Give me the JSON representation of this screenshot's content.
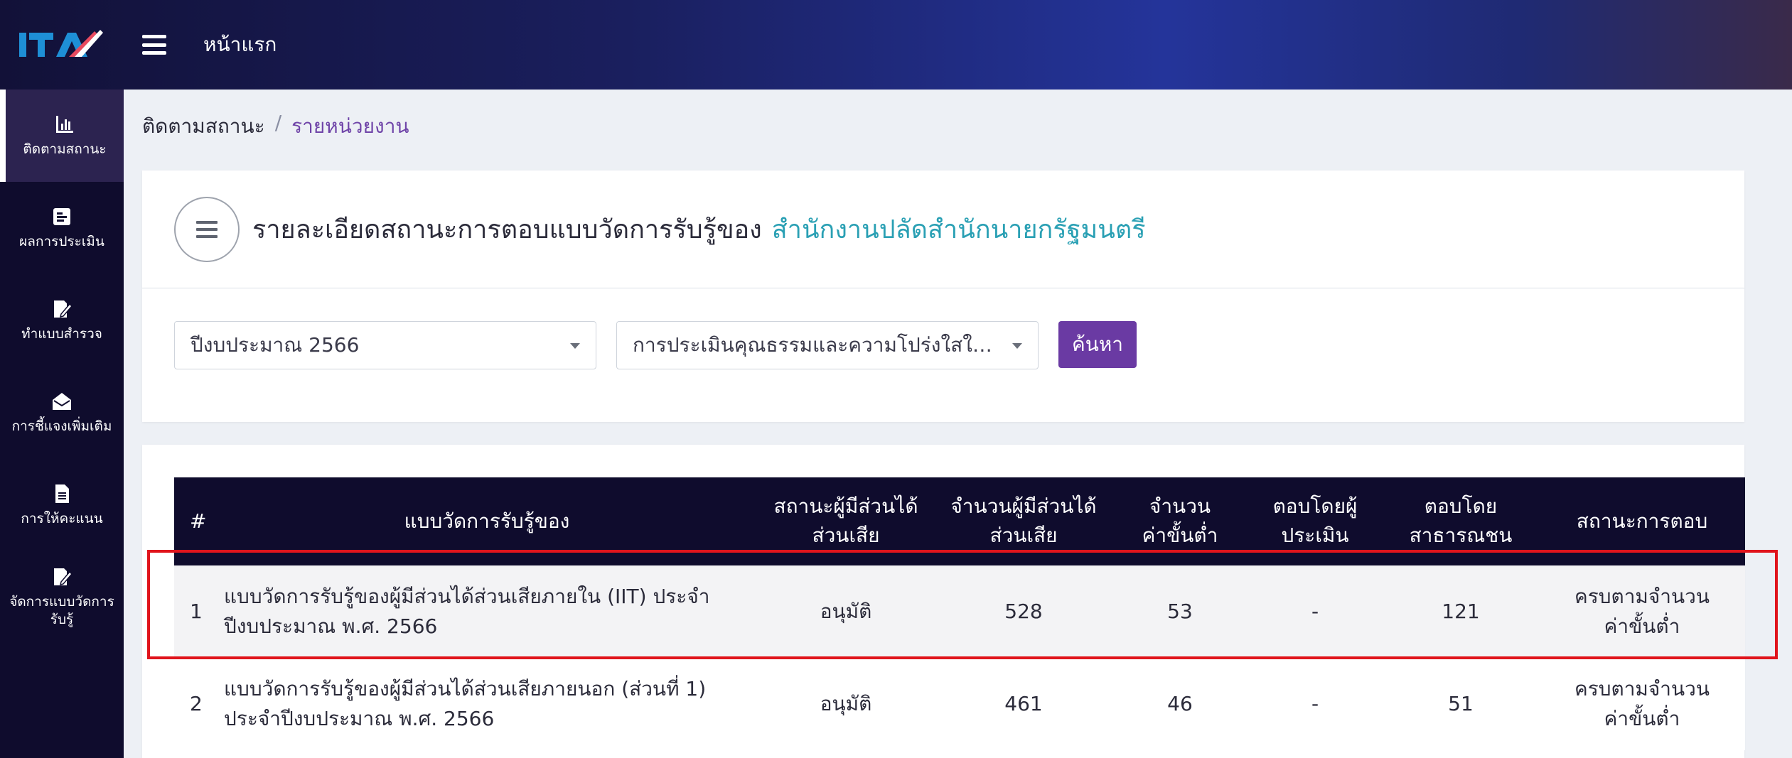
{
  "header": {
    "home_label": "หน้าแรก"
  },
  "sidebar": {
    "items": [
      {
        "label": "ติดตามสถานะ",
        "icon": "bar-chart-icon"
      },
      {
        "label": "ผลการประเมิน",
        "icon": "form-icon"
      },
      {
        "label": "ทำแบบสำรวจ",
        "icon": "edit-document-icon"
      },
      {
        "label": "การชี้แจงเพิ่มเติม",
        "icon": "envelope-icon"
      },
      {
        "label": "การให้คะแนน",
        "icon": "document-icon"
      },
      {
        "label": "จัดการแบบวัดการรับรู้",
        "icon": "edit-document-icon"
      }
    ]
  },
  "breadcrumb": {
    "parent": "ติดตามสถานะ",
    "separator": "/",
    "current": "รายหน่วยงาน"
  },
  "title": {
    "text": "รายละเอียดสถานะการตอบแบบวัดการรับรู้ของ",
    "organization": "สำนักงานปลัดสำนักนายกรัฐมนตรี"
  },
  "filters": {
    "year": "ปีงบประมาณ 2566",
    "assessment": "การประเมินคุณธรรมและความโปร่งใสในกา...",
    "search_label": "ค้นหา"
  },
  "table": {
    "headers": {
      "num": "#",
      "name": "แบบวัดการรับรู้ของ",
      "stakeholder_status": "สถานะผู้มีส่วนได้ส่วนเสีย",
      "stakeholder_count": "จำนวนผู้มีส่วนได้ส่วนเสีย",
      "min_count": "จำนวนค่าขั้นต่ำ",
      "by_assessor": "ตอบโดยผู้ประเมิน",
      "by_public": "ตอบโดยสาธารณชน",
      "response_status": "สถานะการตอบ"
    },
    "rows": [
      {
        "num": "1",
        "name": "แบบวัดการรับรู้ของผู้มีส่วนได้ส่วนเสียภายใน (IIT) ประจำปีงบประมาณ พ.ศ. 2566",
        "stakeholder_status": "อนุมัติ",
        "stakeholder_count": "528",
        "min_count": "53",
        "by_assessor": "-",
        "by_public": "121",
        "response_status": "ครบตามจำนวนค่าขั้นต่ำ"
      },
      {
        "num": "2",
        "name": "แบบวัดการรับรู้ของผู้มีส่วนได้ส่วนเสียภายนอก (ส่วนที่ 1) ประจำปีงบประมาณ พ.ศ. 2566",
        "stakeholder_status": "อนุมัติ",
        "stakeholder_count": "461",
        "min_count": "46",
        "by_assessor": "-",
        "by_public": "51",
        "response_status": "ครบตามจำนวนค่าขั้นต่ำ"
      }
    ]
  },
  "colors": {
    "sidebar": "#0f0c2d",
    "accent": "#6a3aa3",
    "org": "#2aa0b4",
    "highlight": "#e0141c"
  }
}
